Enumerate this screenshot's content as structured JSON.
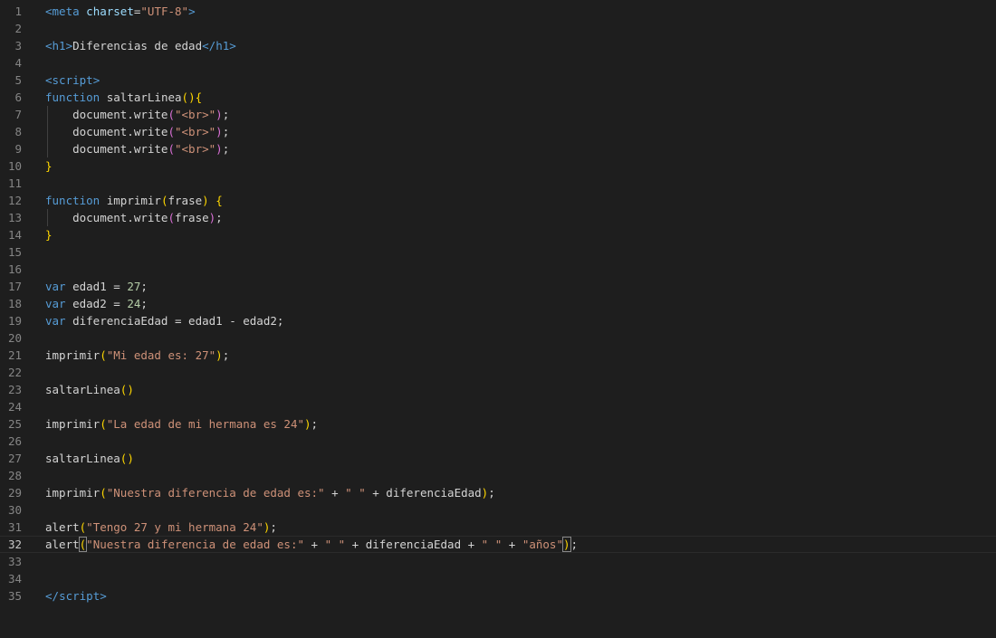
{
  "editor": {
    "language": "html",
    "current_line": 32,
    "lines": [
      {
        "n": "1",
        "tokens": [
          [
            "tag",
            "<"
          ],
          [
            "tagname",
            "meta"
          ],
          [
            "plain",
            " "
          ],
          [
            "attr",
            "charset"
          ],
          [
            "plain",
            "="
          ],
          [
            "str",
            "\"UTF-8\""
          ],
          [
            "tag",
            ">"
          ]
        ]
      },
      {
        "n": "2",
        "tokens": []
      },
      {
        "n": "3",
        "tokens": [
          [
            "tag",
            "<"
          ],
          [
            "tagname",
            "h1"
          ],
          [
            "tag",
            ">"
          ],
          [
            "plain",
            "Diferencias de edad"
          ],
          [
            "tag",
            "</"
          ],
          [
            "tagname",
            "h1"
          ],
          [
            "tag",
            ">"
          ]
        ]
      },
      {
        "n": "4",
        "tokens": []
      },
      {
        "n": "5",
        "tokens": [
          [
            "tag",
            "<"
          ],
          [
            "tagname",
            "script"
          ],
          [
            "tag",
            ">"
          ]
        ]
      },
      {
        "n": "6",
        "tokens": [
          [
            "kw",
            "function"
          ],
          [
            "plain",
            " "
          ],
          [
            "plain",
            "saltarLinea"
          ],
          [
            "br1",
            "()"
          ],
          [
            "br1",
            "{"
          ]
        ]
      },
      {
        "n": "7",
        "guide": true,
        "tokens": [
          [
            "plain",
            "    document.write"
          ],
          [
            "br2",
            "("
          ],
          [
            "str",
            "\"<br>\""
          ],
          [
            "br2",
            ")"
          ],
          [
            "plain",
            ";"
          ]
        ]
      },
      {
        "n": "8",
        "guide": true,
        "tokens": [
          [
            "plain",
            "    document.write"
          ],
          [
            "br2",
            "("
          ],
          [
            "str",
            "\"<br>\""
          ],
          [
            "br2",
            ")"
          ],
          [
            "plain",
            ";"
          ]
        ]
      },
      {
        "n": "9",
        "guide": true,
        "tokens": [
          [
            "plain",
            "    document.write"
          ],
          [
            "br2",
            "("
          ],
          [
            "str",
            "\"<br>\""
          ],
          [
            "br2",
            ")"
          ],
          [
            "plain",
            ";"
          ]
        ]
      },
      {
        "n": "10",
        "tokens": [
          [
            "br1",
            "}"
          ]
        ]
      },
      {
        "n": "11",
        "tokens": []
      },
      {
        "n": "12",
        "tokens": [
          [
            "kw",
            "function"
          ],
          [
            "plain",
            " "
          ],
          [
            "plain",
            "imprimir"
          ],
          [
            "br1",
            "("
          ],
          [
            "plain",
            "frase"
          ],
          [
            "br1",
            ")"
          ],
          [
            "plain",
            " "
          ],
          [
            "br1",
            "{"
          ]
        ]
      },
      {
        "n": "13",
        "guide": true,
        "tokens": [
          [
            "plain",
            "    document.write"
          ],
          [
            "br2",
            "("
          ],
          [
            "plain",
            "frase"
          ],
          [
            "br2",
            ")"
          ],
          [
            "plain",
            ";"
          ]
        ]
      },
      {
        "n": "14",
        "tokens": [
          [
            "br1",
            "}"
          ]
        ]
      },
      {
        "n": "15",
        "tokens": []
      },
      {
        "n": "16",
        "tokens": []
      },
      {
        "n": "17",
        "tokens": [
          [
            "kw",
            "var"
          ],
          [
            "plain",
            " edad1 = "
          ],
          [
            "num",
            "27"
          ],
          [
            "plain",
            ";"
          ]
        ]
      },
      {
        "n": "18",
        "tokens": [
          [
            "kw",
            "var"
          ],
          [
            "plain",
            " edad2 = "
          ],
          [
            "num",
            "24"
          ],
          [
            "plain",
            ";"
          ]
        ]
      },
      {
        "n": "19",
        "tokens": [
          [
            "kw",
            "var"
          ],
          [
            "plain",
            " diferenciaEdad = edad1 - edad2;"
          ]
        ]
      },
      {
        "n": "20",
        "tokens": []
      },
      {
        "n": "21",
        "tokens": [
          [
            "plain",
            "imprimir"
          ],
          [
            "br1",
            "("
          ],
          [
            "str",
            "\"Mi edad es: 27\""
          ],
          [
            "br1",
            ")"
          ],
          [
            "plain",
            ";"
          ]
        ]
      },
      {
        "n": "22",
        "tokens": []
      },
      {
        "n": "23",
        "tokens": [
          [
            "plain",
            "saltarLinea"
          ],
          [
            "br1",
            "()"
          ]
        ]
      },
      {
        "n": "24",
        "tokens": []
      },
      {
        "n": "25",
        "tokens": [
          [
            "plain",
            "imprimir"
          ],
          [
            "br1",
            "("
          ],
          [
            "str",
            "\"La edad de mi hermana es 24\""
          ],
          [
            "br1",
            ")"
          ],
          [
            "plain",
            ";"
          ]
        ]
      },
      {
        "n": "26",
        "tokens": []
      },
      {
        "n": "27",
        "tokens": [
          [
            "plain",
            "saltarLinea"
          ],
          [
            "br1",
            "()"
          ]
        ]
      },
      {
        "n": "28",
        "tokens": []
      },
      {
        "n": "29",
        "tokens": [
          [
            "plain",
            "imprimir"
          ],
          [
            "br1",
            "("
          ],
          [
            "str",
            "\"Nuestra diferencia de edad es:\""
          ],
          [
            "plain",
            " + "
          ],
          [
            "str",
            "\" \""
          ],
          [
            "plain",
            " + diferenciaEdad"
          ],
          [
            "br1",
            ")"
          ],
          [
            "plain",
            ";"
          ]
        ]
      },
      {
        "n": "30",
        "tokens": []
      },
      {
        "n": "31",
        "tokens": [
          [
            "plain",
            "alert"
          ],
          [
            "br1",
            "("
          ],
          [
            "str",
            "\"Tengo 27 y mi hermana 24\""
          ],
          [
            "br1",
            ")"
          ],
          [
            "plain",
            ";"
          ]
        ]
      },
      {
        "n": "32",
        "tokens": [
          [
            "plain",
            "alert"
          ],
          [
            "br1m",
            "("
          ],
          [
            "str",
            "\"Nuestra diferencia de edad es:\""
          ],
          [
            "plain",
            " + "
          ],
          [
            "str",
            "\" \""
          ],
          [
            "plain",
            " + diferenciaEdad + "
          ],
          [
            "str",
            "\" \""
          ],
          [
            "plain",
            " + "
          ],
          [
            "str",
            "\"años\""
          ],
          [
            "br1m",
            ")"
          ],
          [
            "cursor",
            ""
          ],
          [
            "plain",
            ";"
          ]
        ]
      },
      {
        "n": "33",
        "tokens": []
      },
      {
        "n": "34",
        "tokens": []
      },
      {
        "n": "35",
        "tokens": [
          [
            "tag",
            "</"
          ],
          [
            "tagname",
            "script"
          ],
          [
            "tag",
            ">"
          ]
        ]
      }
    ]
  }
}
